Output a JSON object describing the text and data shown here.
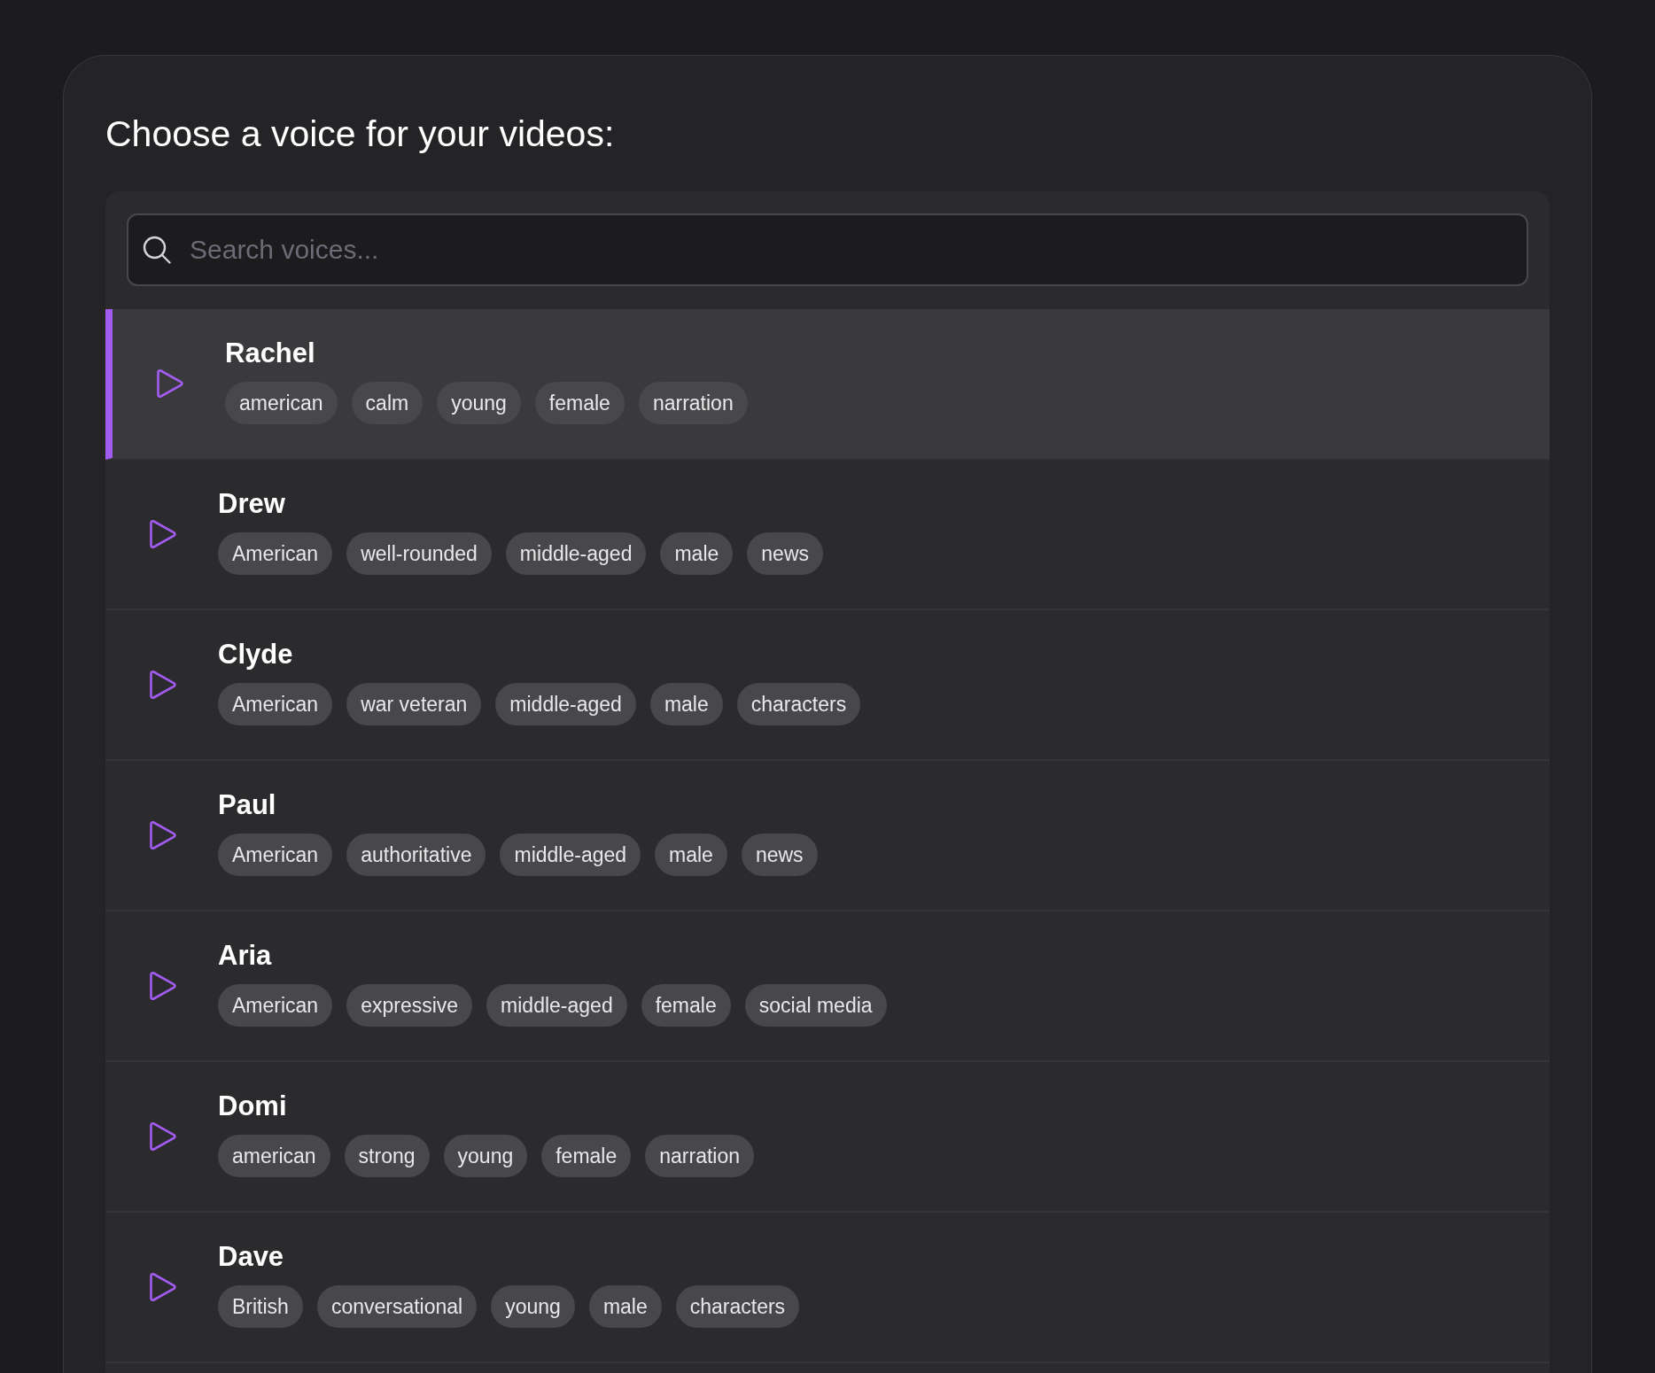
{
  "heading": "Choose a voice for your videos:",
  "search": {
    "placeholder": "Search voices..."
  },
  "voices": [
    {
      "name": "Rachel",
      "selected": true,
      "tags": [
        "american",
        "calm",
        "young",
        "female",
        "narration"
      ]
    },
    {
      "name": "Drew",
      "selected": false,
      "tags": [
        "American",
        "well-rounded",
        "middle-aged",
        "male",
        "news"
      ]
    },
    {
      "name": "Clyde",
      "selected": false,
      "tags": [
        "American",
        "war veteran",
        "middle-aged",
        "male",
        "characters"
      ]
    },
    {
      "name": "Paul",
      "selected": false,
      "tags": [
        "American",
        "authoritative",
        "middle-aged",
        "male",
        "news"
      ]
    },
    {
      "name": "Aria",
      "selected": false,
      "tags": [
        "American",
        "expressive",
        "middle-aged",
        "female",
        "social media"
      ]
    },
    {
      "name": "Domi",
      "selected": false,
      "tags": [
        "american",
        "strong",
        "young",
        "female",
        "narration"
      ]
    },
    {
      "name": "Dave",
      "selected": false,
      "tags": [
        "British",
        "conversational",
        "young",
        "male",
        "characters"
      ]
    }
  ]
}
